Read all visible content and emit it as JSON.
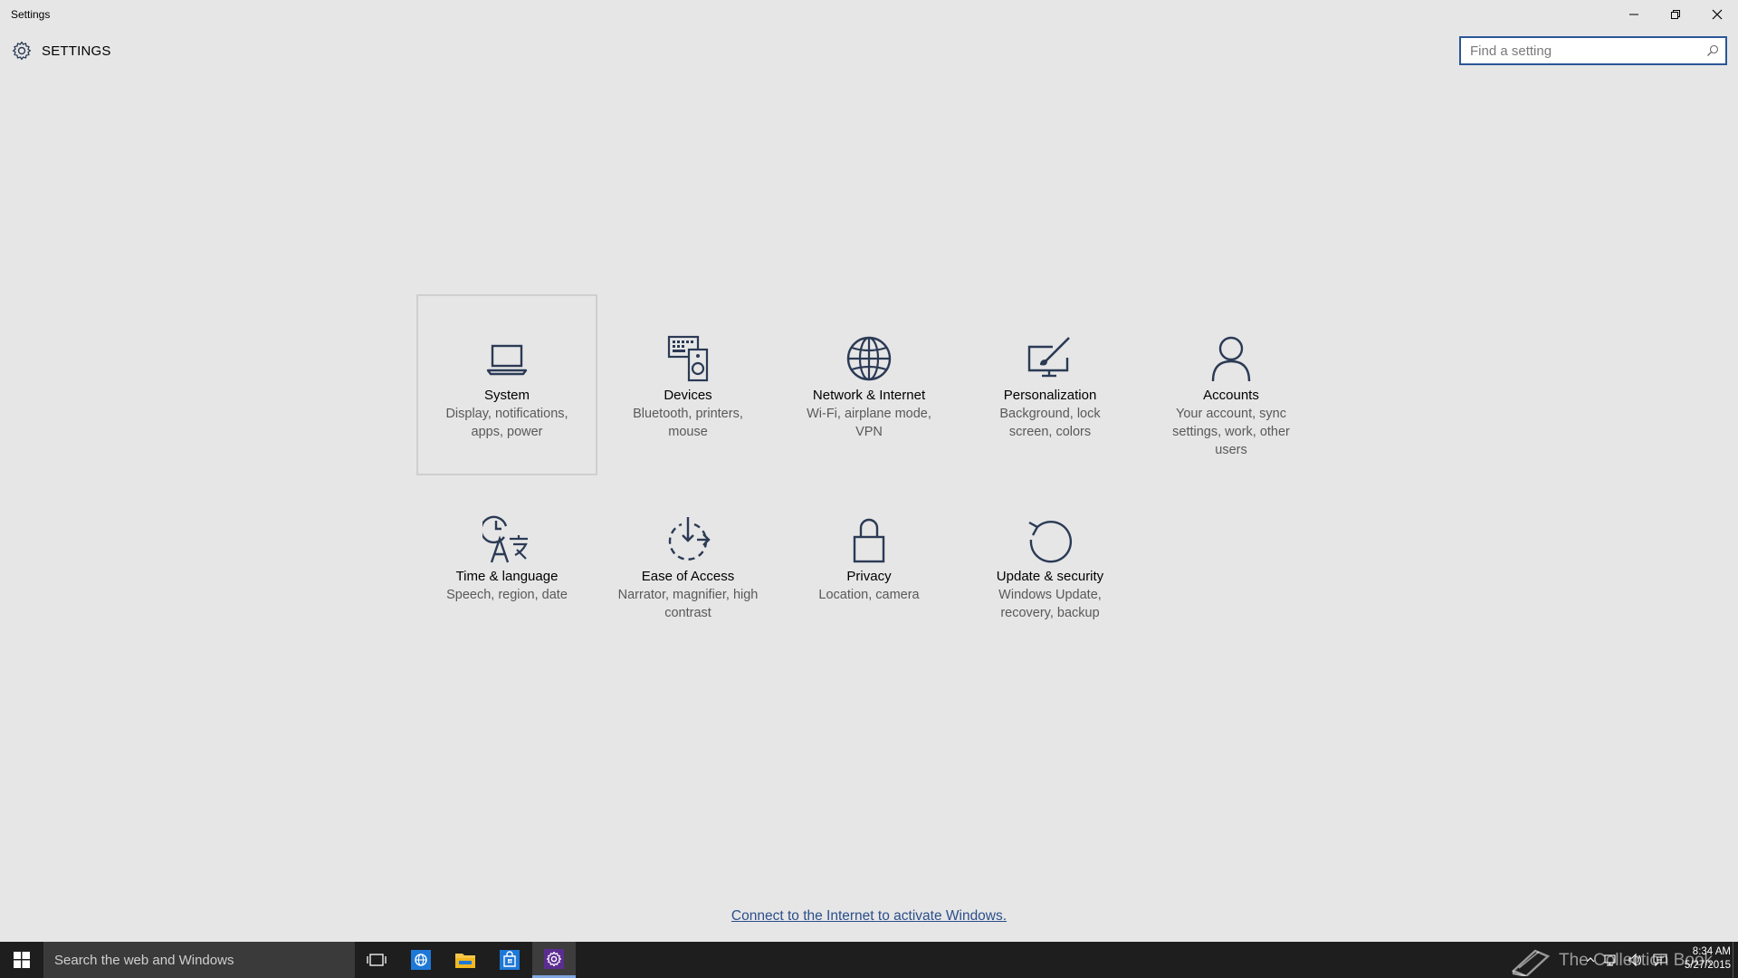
{
  "window": {
    "title": "Settings"
  },
  "header": {
    "label": "SETTINGS"
  },
  "search": {
    "placeholder": "Find a setting"
  },
  "tiles": [
    {
      "name": "System",
      "desc": "Display, notifications, apps, power",
      "icon": "laptop-icon",
      "selected": true
    },
    {
      "name": "Devices",
      "desc": "Bluetooth, printers, mouse",
      "icon": "devices-icon"
    },
    {
      "name": "Network & Internet",
      "desc": "Wi-Fi, airplane mode, VPN",
      "icon": "globe-icon"
    },
    {
      "name": "Personalization",
      "desc": "Background, lock screen, colors",
      "icon": "paintbrush-monitor-icon"
    },
    {
      "name": "Accounts",
      "desc": "Your account, sync settings, work, other users",
      "icon": "person-icon"
    },
    {
      "name": "Time & language",
      "desc": "Speech, region, date",
      "icon": "clock-language-icon"
    },
    {
      "name": "Ease of Access",
      "desc": "Narrator, magnifier, high contrast",
      "icon": "ease-of-access-icon"
    },
    {
      "name": "Privacy",
      "desc": "Location, camera",
      "icon": "lock-icon"
    },
    {
      "name": "Update & security",
      "desc": "Windows Update, recovery, backup",
      "icon": "refresh-icon"
    }
  ],
  "footer": {
    "activate_link": "Connect to the Internet to activate Windows."
  },
  "taskbar": {
    "search_text": "Search the web and Windows",
    "time": "8:34 AM",
    "date": "5/27/2015",
    "watermark": "The Collection Book"
  },
  "colors": {
    "background": "#e6e6e6",
    "accent": "#2b5797",
    "icon": "#2b3a55",
    "taskbar": "#1e1e1e"
  }
}
